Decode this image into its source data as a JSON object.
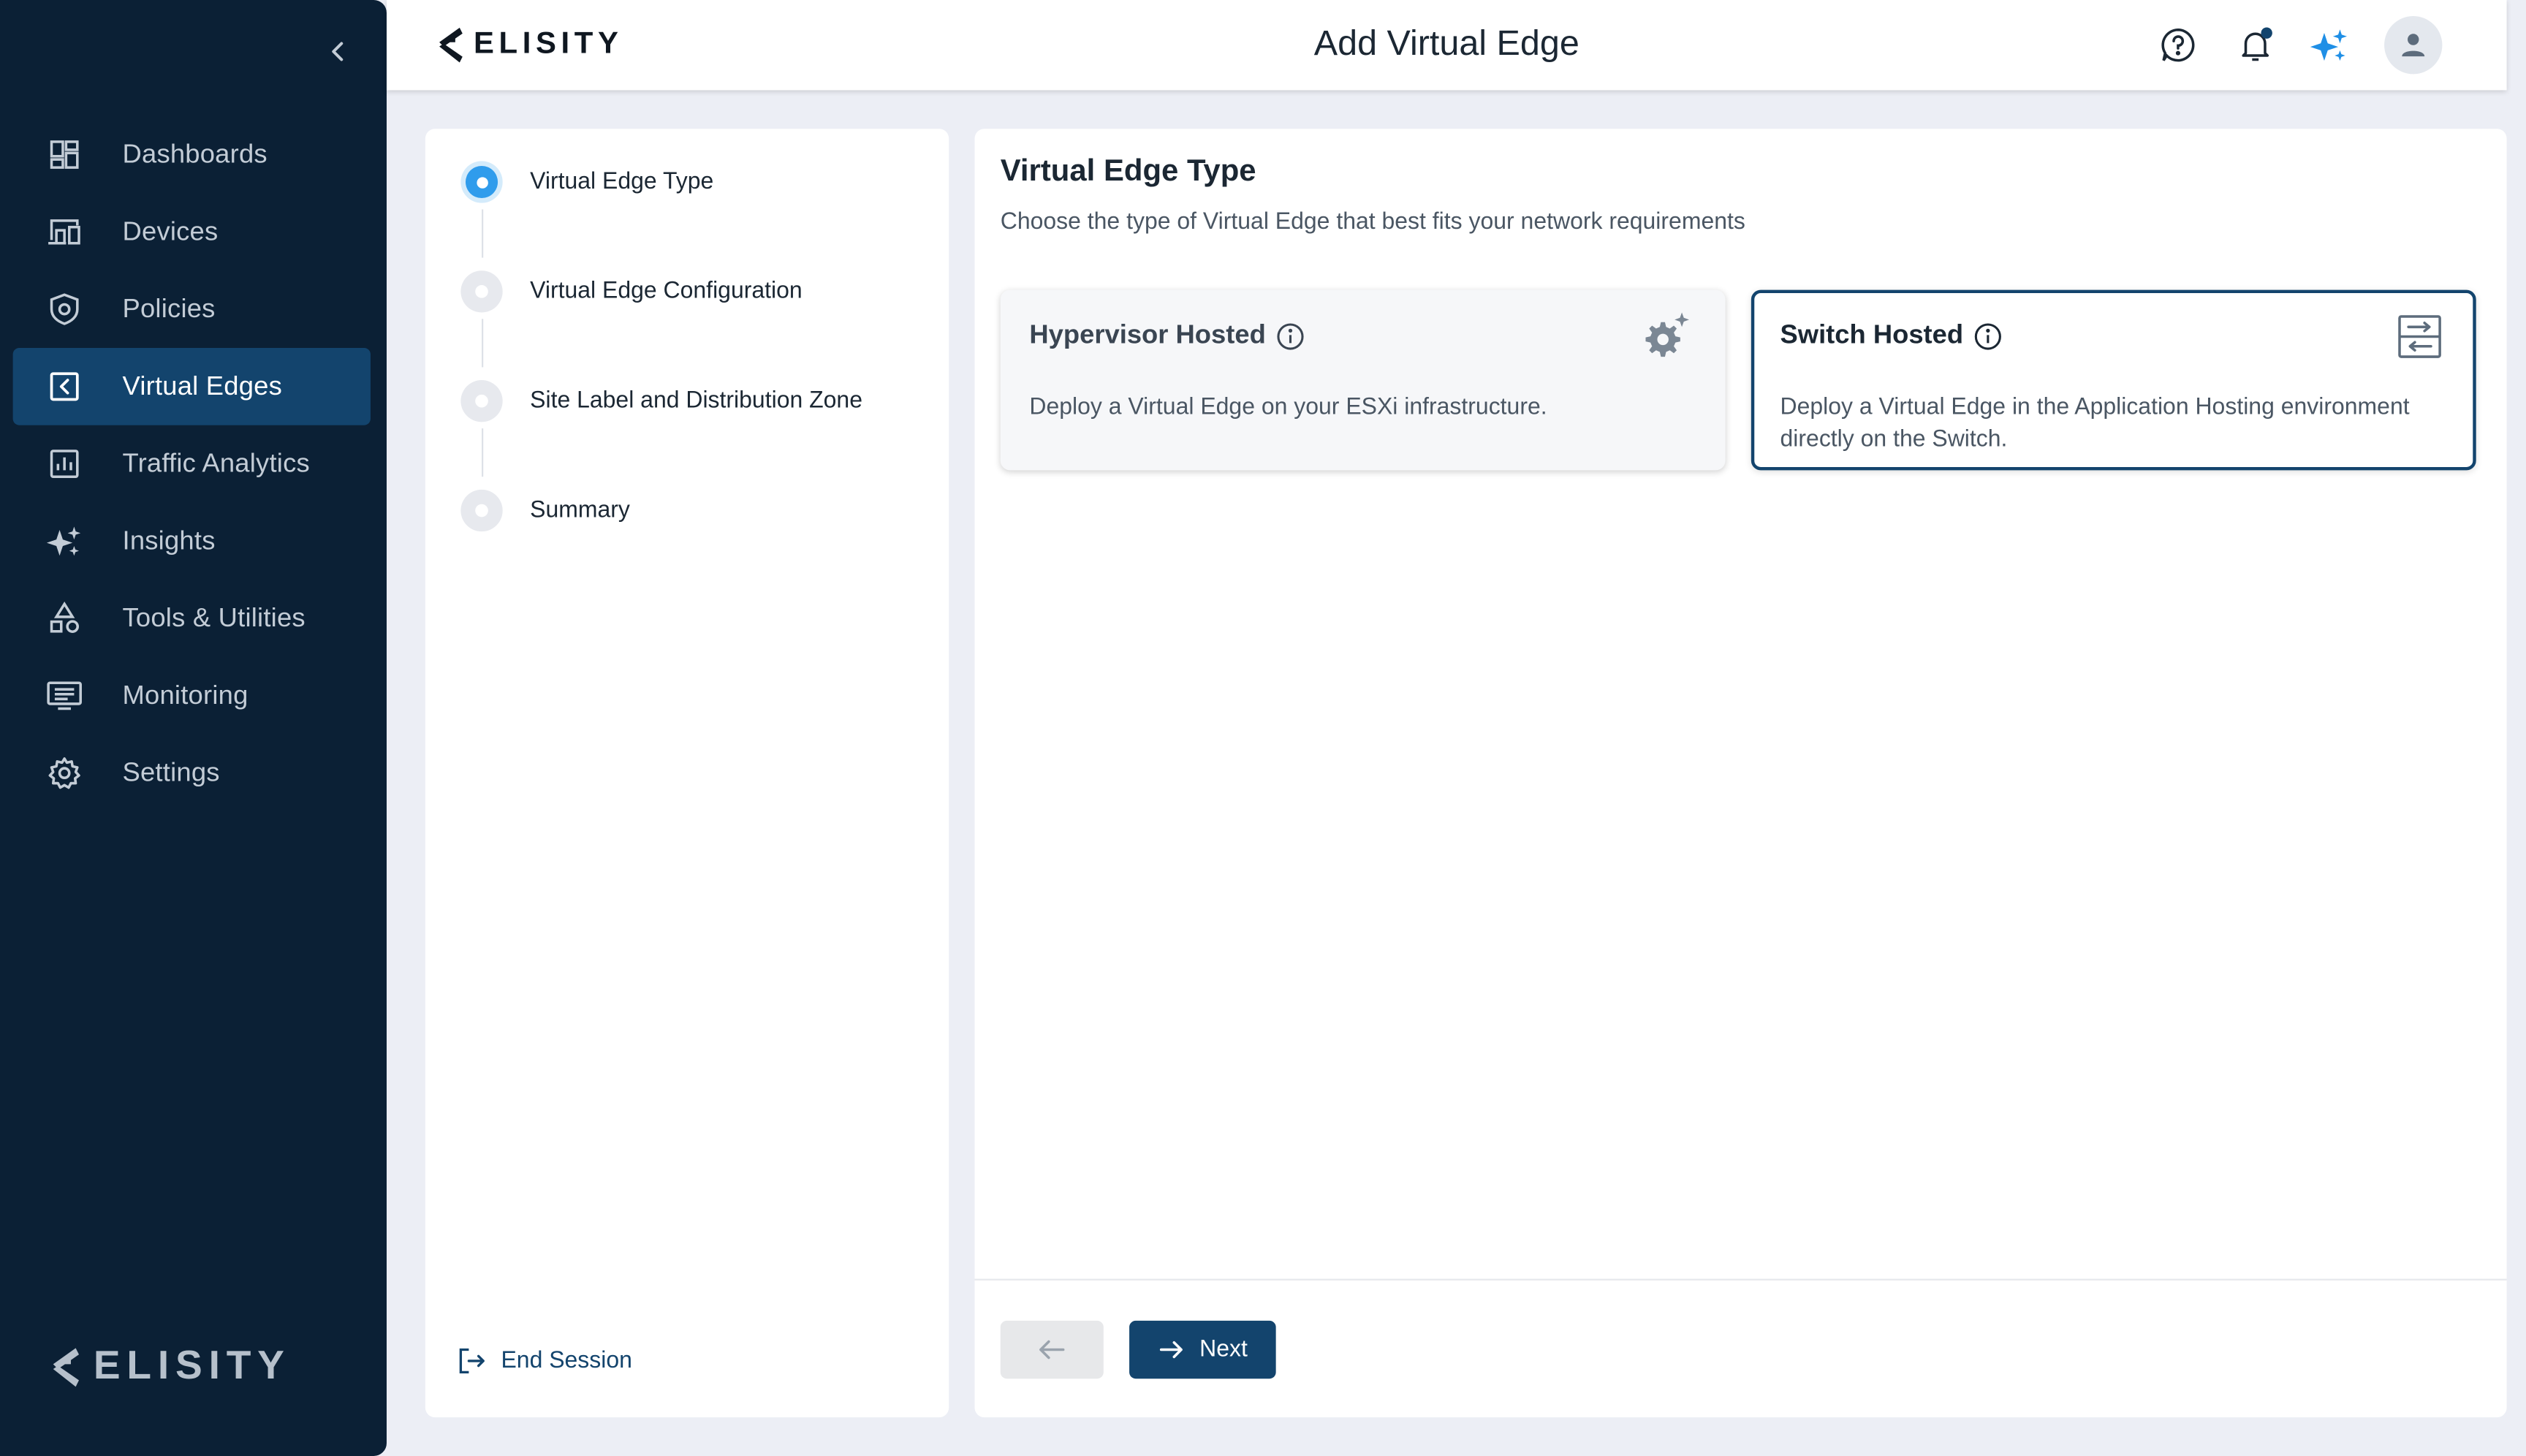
{
  "app": {
    "brand": "ELISITY",
    "page_title": "Add Virtual Edge"
  },
  "sidebar": {
    "items": [
      {
        "label": "Dashboards",
        "icon": "dashboard-icon"
      },
      {
        "label": "Devices",
        "icon": "devices-icon"
      },
      {
        "label": "Policies",
        "icon": "shield-icon"
      },
      {
        "label": "Virtual Edges",
        "icon": "virtual-edge-icon",
        "active": true
      },
      {
        "label": "Traffic Analytics",
        "icon": "bar-chart-icon"
      },
      {
        "label": "Insights",
        "icon": "sparkle-icon"
      },
      {
        "label": "Tools & Utilities",
        "icon": "shapes-icon"
      },
      {
        "label": "Monitoring",
        "icon": "monitor-icon"
      },
      {
        "label": "Settings",
        "icon": "gear-icon"
      }
    ],
    "footer_brand": "ELISITY"
  },
  "stepper": {
    "steps": [
      {
        "label": "Virtual Edge Type",
        "active": true
      },
      {
        "label": "Virtual Edge Configuration"
      },
      {
        "label": "Site Label and Distribution Zone"
      },
      {
        "label": "Summary"
      }
    ],
    "end_session": "End Session"
  },
  "content": {
    "title": "Virtual Edge Type",
    "subtitle": "Choose the type of Virtual Edge that best fits your network requirements",
    "cards": [
      {
        "title": "Hypervisor Hosted",
        "description": "Deploy a Virtual Edge on your ESXi infrastructure.",
        "icon": "gear-sparkle-icon"
      },
      {
        "title": "Switch Hosted",
        "description": "Deploy a Virtual Edge in the Application Hosting environment directly on the Switch.",
        "icon": "switch-icon",
        "selected": true
      }
    ],
    "next_label": "Next"
  },
  "colors": {
    "sidebar_bg": "#0b2035",
    "active_nav": "#13446d",
    "primary": "#13446d",
    "accent": "#2f9cec",
    "notification_dot": "#13446d"
  }
}
